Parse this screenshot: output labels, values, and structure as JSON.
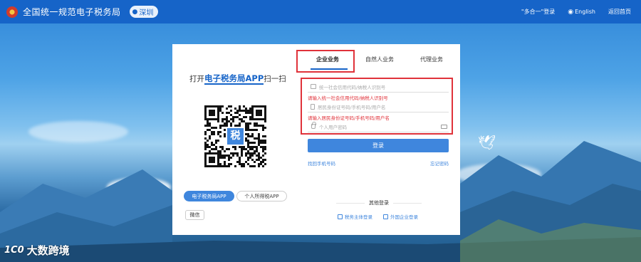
{
  "header": {
    "title": "全国统一规范电子税务局",
    "city": "深圳",
    "links": [
      "\"多合一\"登录",
      "English",
      "返回首页"
    ]
  },
  "qr_panel": {
    "scan_prefix": "打开",
    "scan_app": "电子税务局APP",
    "scan_suffix": "扫一扫",
    "qr_logo_char": "税",
    "app_tabs": [
      "电子税务局APP",
      "个人所得税APP"
    ],
    "wechat_label": "微信"
  },
  "form": {
    "tabs": [
      "企业业务",
      "自然人业务",
      "代理业务"
    ],
    "field1_placeholder": "统一社会信用代码/纳税人识别号",
    "field1_error": "请输入统一社会信用代码/纳税人识别号",
    "field2_placeholder": "居民身份证号码/手机号码/用户名",
    "field2_error": "请输入居民身份证号码/手机号码/用户名",
    "field3_placeholder": "个人用户密码",
    "login_button": "登录",
    "link_left": "找回手机号码",
    "link_right": "忘记密码",
    "other_title": "其他登录",
    "other_options": [
      "税务主体登录",
      "外国企业登录"
    ]
  },
  "watermark": {
    "logo": "1C0",
    "text": "大数跨境"
  },
  "colors": {
    "topbar": "#1664c8",
    "accent": "#3f86dd",
    "error": "#e0323a"
  }
}
